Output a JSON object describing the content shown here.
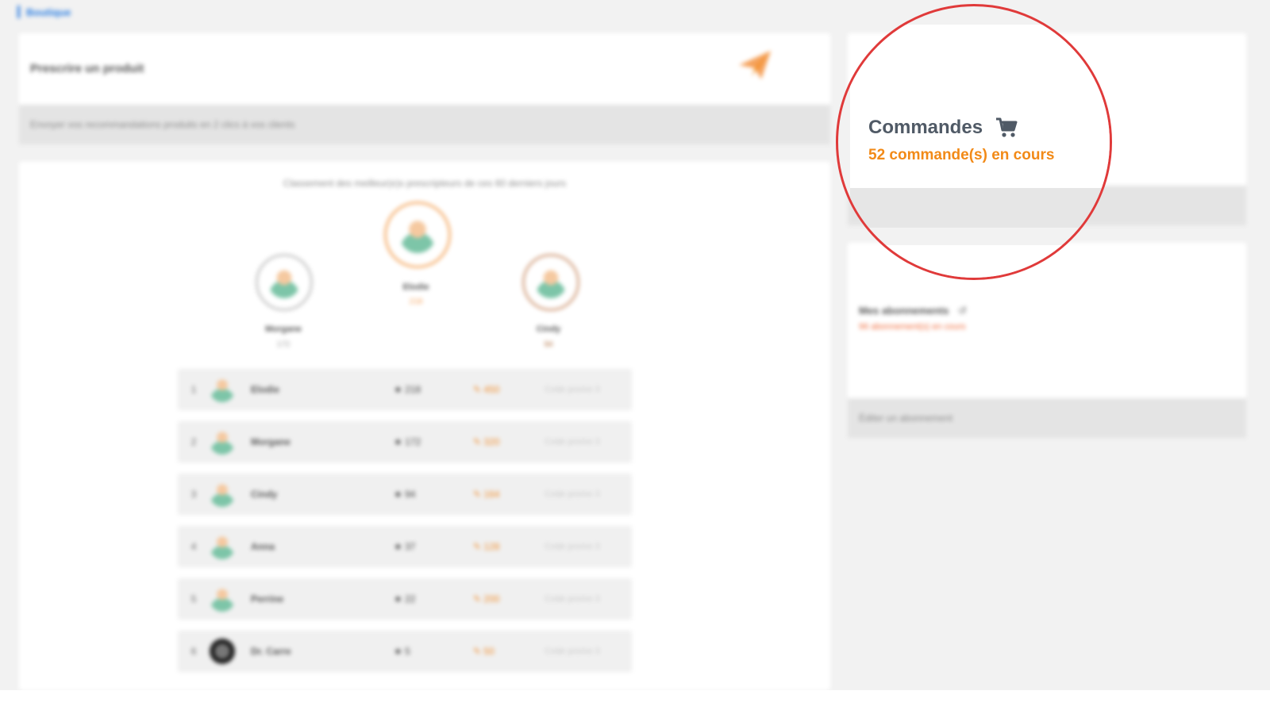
{
  "breadcrumb": {
    "label": "Boutique"
  },
  "prescribe": {
    "title": "Prescrire un produit",
    "footer": "Envoyer vos recommandations produits en 2 clics à vos clients",
    "icon": "paper-plane-icon",
    "accent": "#f28a17"
  },
  "ranking": {
    "caption": "Classement des meilleur(e)s prescripteurs de ces 60 derniers jours",
    "podium": [
      {
        "name": "Morgane",
        "score": "172"
      },
      {
        "name": "Elodie",
        "score": "218"
      },
      {
        "name": "Cindy",
        "score": "94"
      }
    ],
    "rows": [
      {
        "rank": "1",
        "name": "Elodie",
        "stars": "218",
        "orders": "450",
        "promo": "Code promo 3"
      },
      {
        "rank": "2",
        "name": "Morgane",
        "stars": "172",
        "orders": "320",
        "promo": "Code promo 3"
      },
      {
        "rank": "3",
        "name": "Cindy",
        "stars": "94",
        "orders": "164",
        "promo": "Code promo 3"
      },
      {
        "rank": "4",
        "name": "Anna",
        "stars": "37",
        "orders": "128",
        "promo": "Code promo 3"
      },
      {
        "rank": "5",
        "name": "Perrine",
        "stars": "22",
        "orders": "200",
        "promo": "Code promo 3"
      },
      {
        "rank": "6",
        "name": "Dr. Carre",
        "stars": "5",
        "orders": "50",
        "promo": "Code promo 3"
      }
    ]
  },
  "orders": {
    "title": "Commandes",
    "count_text": "52 commande(s) en cours",
    "icon": "shopping-cart-icon",
    "title_color": "#505a66",
    "count_color": "#f28a17"
  },
  "subscriptions": {
    "title": "Mes abonnements",
    "count_text": "96 abonnement(s) en cours",
    "footer": "Éditer un abonnement",
    "icon": "refresh-icon"
  },
  "highlight": {
    "color": "#e03a3a"
  }
}
